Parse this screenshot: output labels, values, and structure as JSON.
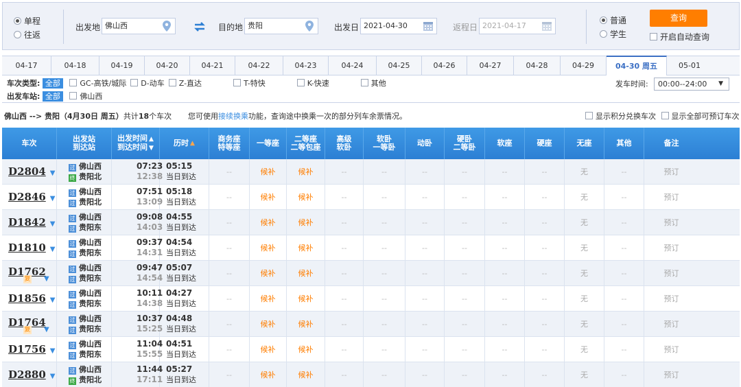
{
  "search": {
    "trip_types": [
      {
        "label": "单程",
        "selected": true
      },
      {
        "label": "往返",
        "selected": false
      }
    ],
    "from_label": "出发地",
    "from_value": "佛山西",
    "to_label": "目的地",
    "to_value": "贵阳",
    "depart_label": "出发日",
    "depart_value": "2021-04-30",
    "return_label": "返程日",
    "return_value": "2021-04-17",
    "passenger_types": [
      {
        "label": "普通",
        "selected": true
      },
      {
        "label": "学生",
        "selected": false
      }
    ],
    "search_button": "查询",
    "auto_query": "开启自动查询"
  },
  "date_tabs": [
    {
      "label": "04-17",
      "active": false
    },
    {
      "label": "04-18",
      "active": false
    },
    {
      "label": "04-19",
      "active": false
    },
    {
      "label": "04-20",
      "active": false
    },
    {
      "label": "04-21",
      "active": false
    },
    {
      "label": "04-22",
      "active": false
    },
    {
      "label": "04-23",
      "active": false
    },
    {
      "label": "04-24",
      "active": false
    },
    {
      "label": "04-25",
      "active": false
    },
    {
      "label": "04-26",
      "active": false
    },
    {
      "label": "04-27",
      "active": false
    },
    {
      "label": "04-28",
      "active": false
    },
    {
      "label": "04-29",
      "active": false
    },
    {
      "label": "04-30 周五",
      "active": true
    },
    {
      "label": "05-01",
      "active": false
    }
  ],
  "filters": {
    "type_label": "车次类型:",
    "station_label": "出发车站:",
    "all_label": "全部",
    "train_types": [
      "GC-高铁/城际",
      "D-动车",
      "Z-直达",
      "T-特快",
      "K-快速",
      "其他"
    ],
    "stations": [
      "佛山西"
    ],
    "time_label": "发车时间:",
    "time_value": "00:00--24:00"
  },
  "summary": {
    "route": "佛山西 --> 贵阳（4月30日 周五）",
    "count_prefix": "共计",
    "count": "18",
    "count_suffix": "个车次",
    "hint_prefix": "您可使用",
    "hint_link": "接续换乘",
    "hint_suffix": "功能，查询途中换乘一次的部分列车余票情况。",
    "toggle_points": "显示积分兑换车次",
    "toggle_all": "显示全部可预订车次"
  },
  "table": {
    "headers": {
      "train": "车次",
      "stations_1": "出发站",
      "stations_2": "到达站",
      "time_1": "出发时间",
      "time_2": "到达时间",
      "duration": "历时",
      "business_1": "商务座",
      "business_2": "特等座",
      "first": "一等座",
      "second_1": "二等座",
      "second_2": "二等包座",
      "soft_premium_1": "高级",
      "soft_premium_2": "软卧",
      "soft_sleeper_1": "软卧",
      "soft_sleeper_2": "一等卧",
      "moving_sleeper": "动卧",
      "hard_sleeper_1": "硬卧",
      "hard_sleeper_2": "二等卧",
      "soft_seat": "软座",
      "hard_seat": "硬座",
      "standing": "无座",
      "other": "其他",
      "remark": "备注"
    },
    "tags": {
      "pass": "过",
      "end": "终"
    },
    "fu_label": "复",
    "rows": [
      {
        "train": "D2804",
        "fu": false,
        "from": "佛山西",
        "to": "贵阳北",
        "to_tag": "end",
        "dep": "07:23",
        "arr": "12:38",
        "dur": "05:15",
        "note": "当日到达",
        "business": "--",
        "first": "候补",
        "second": "候补",
        "premium": "--",
        "soft": "--",
        "moving": "--",
        "hard": "--",
        "softseat": "--",
        "hardseat": "--",
        "stand": "无",
        "other": "--",
        "remark": "预订"
      },
      {
        "train": "D2846",
        "fu": false,
        "from": "佛山西",
        "to": "贵阳北",
        "to_tag": "pass",
        "dep": "07:51",
        "arr": "13:09",
        "dur": "05:18",
        "note": "当日到达",
        "business": "--",
        "first": "候补",
        "second": "候补",
        "premium": "--",
        "soft": "--",
        "moving": "--",
        "hard": "--",
        "softseat": "--",
        "hardseat": "--",
        "stand": "无",
        "other": "--",
        "remark": "预订"
      },
      {
        "train": "D1842",
        "fu": false,
        "from": "佛山西",
        "to": "贵阳东",
        "to_tag": "pass",
        "dep": "09:08",
        "arr": "14:03",
        "dur": "04:55",
        "note": "当日到达",
        "business": "--",
        "first": "候补",
        "second": "候补",
        "premium": "--",
        "soft": "--",
        "moving": "--",
        "hard": "--",
        "softseat": "--",
        "hardseat": "--",
        "stand": "无",
        "other": "--",
        "remark": "预订"
      },
      {
        "train": "D1810",
        "fu": false,
        "from": "佛山西",
        "to": "贵阳东",
        "to_tag": "pass",
        "dep": "09:37",
        "arr": "14:31",
        "dur": "04:54",
        "note": "当日到达",
        "business": "--",
        "first": "候补",
        "second": "候补",
        "premium": "--",
        "soft": "--",
        "moving": "--",
        "hard": "--",
        "softseat": "--",
        "hardseat": "--",
        "stand": "无",
        "other": "--",
        "remark": "预订"
      },
      {
        "train": "D1762",
        "fu": true,
        "from": "佛山西",
        "to": "贵阳东",
        "to_tag": "pass",
        "dep": "09:47",
        "arr": "14:54",
        "dur": "05:07",
        "note": "当日到达",
        "business": "--",
        "first": "候补",
        "second": "候补",
        "premium": "--",
        "soft": "--",
        "moving": "--",
        "hard": "--",
        "softseat": "--",
        "hardseat": "--",
        "stand": "无",
        "other": "--",
        "remark": "预订"
      },
      {
        "train": "D1856",
        "fu": false,
        "from": "佛山西",
        "to": "贵阳东",
        "to_tag": "pass",
        "dep": "10:11",
        "arr": "14:38",
        "dur": "04:27",
        "note": "当日到达",
        "business": "--",
        "first": "候补",
        "second": "候补",
        "premium": "--",
        "soft": "--",
        "moving": "--",
        "hard": "--",
        "softseat": "--",
        "hardseat": "--",
        "stand": "无",
        "other": "--",
        "remark": "预订"
      },
      {
        "train": "D1764",
        "fu": true,
        "from": "佛山西",
        "to": "贵阳东",
        "to_tag": "pass",
        "dep": "10:37",
        "arr": "15:25",
        "dur": "04:48",
        "note": "当日到达",
        "business": "--",
        "first": "候补",
        "second": "候补",
        "premium": "--",
        "soft": "--",
        "moving": "--",
        "hard": "--",
        "softseat": "--",
        "hardseat": "--",
        "stand": "无",
        "other": "--",
        "remark": "预订"
      },
      {
        "train": "D1756",
        "fu": false,
        "from": "佛山西",
        "to": "贵阳东",
        "to_tag": "pass",
        "dep": "11:04",
        "arr": "15:55",
        "dur": "04:51",
        "note": "当日到达",
        "business": "--",
        "first": "候补",
        "second": "候补",
        "premium": "--",
        "soft": "--",
        "moving": "--",
        "hard": "--",
        "softseat": "--",
        "hardseat": "--",
        "stand": "无",
        "other": "--",
        "remark": "预订"
      },
      {
        "train": "D2880",
        "fu": false,
        "from": "佛山西",
        "to": "贵阳北",
        "to_tag": "end",
        "dep": "11:44",
        "arr": "17:11",
        "dur": "05:27",
        "note": "当日到达",
        "business": "--",
        "first": "候补",
        "second": "候补",
        "premium": "--",
        "soft": "--",
        "moving": "--",
        "hard": "--",
        "softseat": "--",
        "hardseat": "--",
        "stand": "无",
        "other": "--",
        "remark": "预订"
      }
    ]
  },
  "colors": {
    "accent": "#3b8ee0",
    "header": "#2c7fd4",
    "search_button": "#ff7e00",
    "waitlist": "#ff7e00"
  }
}
